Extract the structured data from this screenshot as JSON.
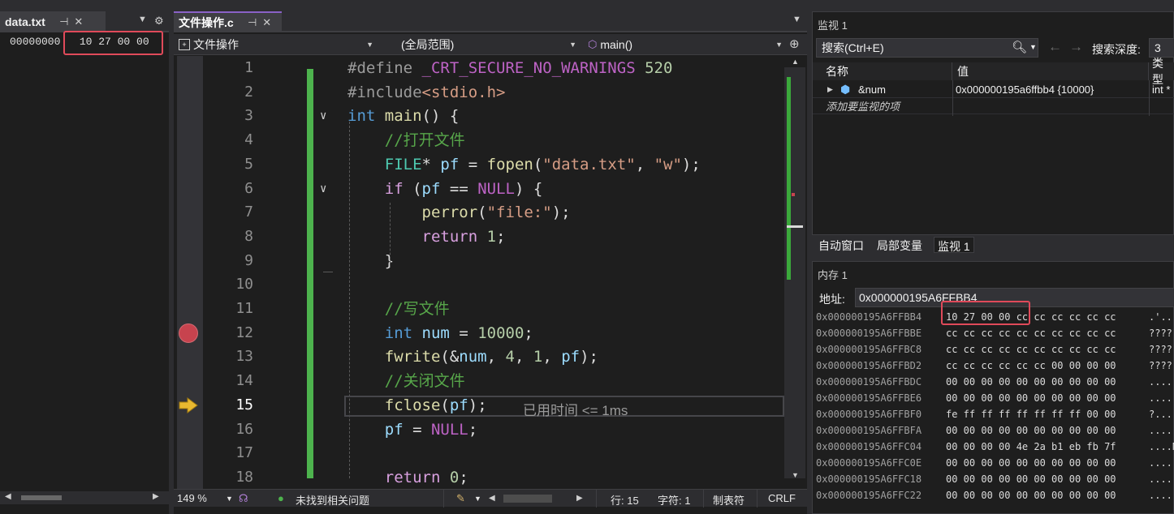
{
  "left_pane": {
    "tab_title": "data.txt",
    "pin_icon": "⊣",
    "close_icon": "✕",
    "hex_address": "00000000",
    "hex_bytes": "10 27 00 00"
  },
  "editor": {
    "tab_title": "文件操作.c",
    "nav": {
      "project": "文件操作",
      "scope": "(全局范围)",
      "member": "main()"
    },
    "lines": [
      {
        "n": "1",
        "html": "<span style='color:#9b9b9b'>#define</span> <span style='color:#bd63c5'>_CRT_SECURE_NO_WARNINGS</span> <span style='color:#b5cea8'>520</span>"
      },
      {
        "n": "2",
        "html": "<span style='color:#9b9b9b'>#include</span><span style='color:#d69d85'>&lt;stdio.h&gt;</span>"
      },
      {
        "n": "3",
        "html": "<span style='color:#569cd6'>int</span> <span style='color:#dcdcaa'>main</span>() {"
      },
      {
        "n": "4",
        "html": "    <span style='color:#57a64a'>//打开文件</span>"
      },
      {
        "n": "5",
        "html": "    <span style='color:#4ec9b0'>FILE</span>* <span style='color:#9cdcfe'>pf</span> = <span style='color:#dcdcaa'>fopen</span>(<span style='color:#d69d85'>\"data.txt\"</span>, <span style='color:#d69d85'>\"w\"</span>);"
      },
      {
        "n": "6",
        "html": "    <span style='color:#d8a0df'>if</span> (<span style='color:#9cdcfe'>pf</span> == <span style='color:#bd63c5'>NULL</span>) {"
      },
      {
        "n": "7",
        "html": "        <span style='color:#dcdcaa'>perror</span>(<span style='color:#d69d85'>\"file:\"</span>);"
      },
      {
        "n": "8",
        "html": "        <span style='color:#d8a0df'>return</span> <span style='color:#b5cea8'>1</span>;"
      },
      {
        "n": "9",
        "html": "    }"
      },
      {
        "n": "10",
        "html": ""
      },
      {
        "n": "11",
        "html": "    <span style='color:#57a64a'>//写文件</span>"
      },
      {
        "n": "12",
        "html": "    <span style='color:#569cd6'>int</span> <span style='color:#9cdcfe'>num</span> = <span style='color:#b5cea8'>10000</span>;"
      },
      {
        "n": "13",
        "html": "    <span style='color:#dcdcaa'>fwrite</span>(&amp;<span style='color:#9cdcfe'>num</span>, <span style='color:#b5cea8'>4</span>, <span style='color:#b5cea8'>1</span>, <span style='color:#9cdcfe'>pf</span>);"
      },
      {
        "n": "14",
        "html": "    <span style='color:#57a64a'>//关闭文件</span>"
      },
      {
        "n": "15",
        "html": "    <span style='color:#dcdcaa'>fclose</span>(<span style='color:#9cdcfe'>pf</span>);"
      },
      {
        "n": "16",
        "html": "    <span style='color:#9cdcfe'>pf</span> = <span style='color:#bd63c5'>NULL</span>;"
      },
      {
        "n": "17",
        "html": ""
      },
      {
        "n": "18",
        "html": "    <span style='color:#d8a0df'>return</span> <span style='color:#b5cea8'>0</span>;"
      }
    ],
    "elapsed_hint": "已用时间 <= 1ms"
  },
  "statusbar": {
    "zoom": "149 %",
    "issues": "未找到相关问题",
    "line": "行: 15",
    "col": "字符: 1",
    "tabs": "制表符",
    "eol": "CRLF"
  },
  "watch": {
    "title": "监视 1",
    "search_placeholder": "搜索(Ctrl+E)",
    "depth_label": "搜索深度:",
    "depth_value": "3",
    "col_name": "名称",
    "col_value": "值",
    "col_type": "类型",
    "row_name": "&num",
    "row_value": "0x000000195a6ffbb4 {10000}",
    "row_type": "int *",
    "add_item": "添加要监视的项",
    "tabs": [
      "自动窗口",
      "局部变量",
      "监视 1"
    ]
  },
  "memory": {
    "title": "内存 1",
    "addr_label": "地址:",
    "addr_value": "0x000000195A6FFBB4",
    "rows": [
      {
        "addr": "0x000000195A6FFBB4",
        "bytes": "10 27 00 00 cc cc cc cc cc cc",
        "chars": ".'.."
      },
      {
        "addr": "0x000000195A6FFBBE",
        "bytes": "cc cc cc cc cc cc cc cc cc cc",
        "chars": "????"
      },
      {
        "addr": "0x000000195A6FFBC8",
        "bytes": "cc cc cc cc cc cc cc cc cc cc",
        "chars": "????"
      },
      {
        "addr": "0x000000195A6FFBD2",
        "bytes": "cc cc cc cc cc cc 00 00 00 00",
        "chars": "????"
      },
      {
        "addr": "0x000000195A6FFBDC",
        "bytes": "00 00 00 00 00 00 00 00 00 00",
        "chars": "...."
      },
      {
        "addr": "0x000000195A6FFBE6",
        "bytes": "00 00 00 00 00 00 00 00 00 00",
        "chars": "...."
      },
      {
        "addr": "0x000000195A6FFBF0",
        "bytes": "fe ff ff ff ff ff ff ff 00 00",
        "chars": "?..."
      },
      {
        "addr": "0x000000195A6FFBFA",
        "bytes": "00 00 00 00 00 00 00 00 00 00",
        "chars": "...."
      },
      {
        "addr": "0x000000195A6FFC04",
        "bytes": "00 00 00 00 4e 2a b1 eb fb 7f",
        "chars": "....N"
      },
      {
        "addr": "0x000000195A6FFC0E",
        "bytes": "00 00 00 00 00 00 00 00 00 00",
        "chars": "...."
      },
      {
        "addr": "0x000000195A6FFC18",
        "bytes": "00 00 00 00 00 00 00 00 00 00",
        "chars": "...."
      },
      {
        "addr": "0x000000195A6FFC22",
        "bytes": "00 00 00 00 00 00 00 00 00 00",
        "chars": "...."
      }
    ]
  }
}
